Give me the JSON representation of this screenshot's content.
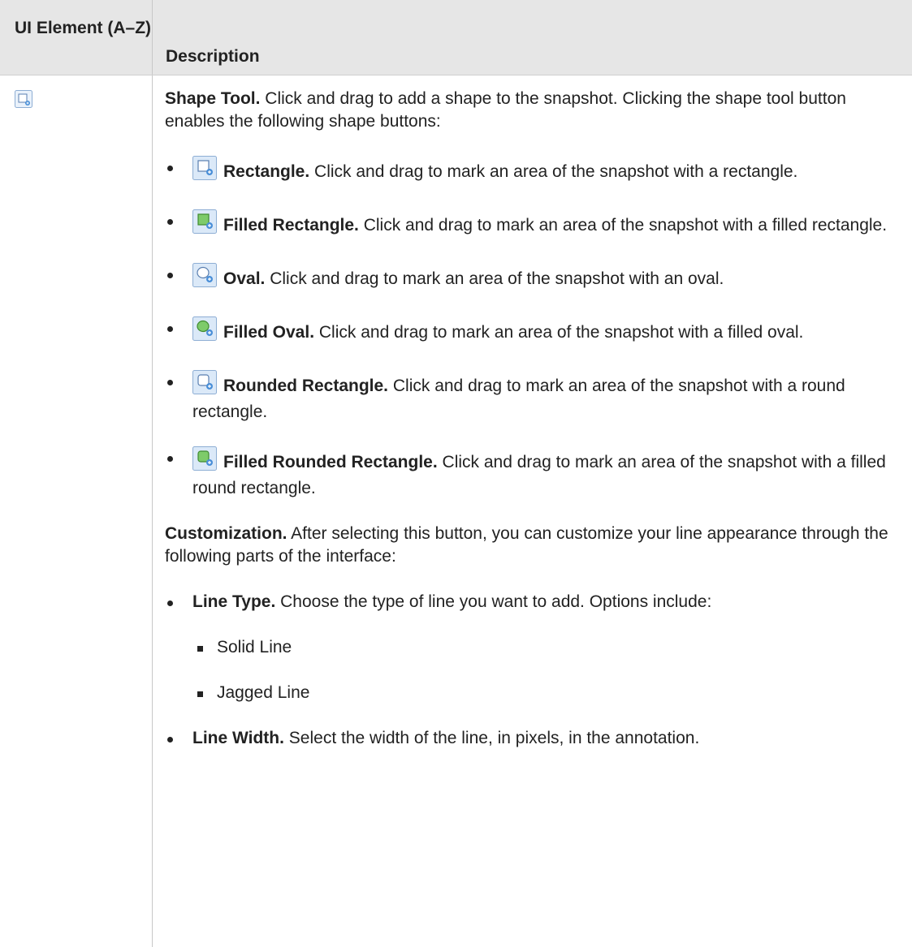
{
  "header": {
    "col1": "UI Element (A–Z)",
    "col2": "Description"
  },
  "row": {
    "element_icon": "shape-tool-icon",
    "title": "Shape Tool.",
    "intro": " Click and drag to add a shape to the snapshot. Clicking the shape tool button enables the following shape buttons:",
    "shapes": [
      {
        "icon": "rectangle-icon",
        "name": "Rectangle.",
        "desc": " Click and drag to mark an area of the snapshot with a rectangle."
      },
      {
        "icon": "filled-rectangle-icon",
        "name": "Filled Rectangle.",
        "desc": " Click and drag to mark an area of the snapshot with a filled rectangle."
      },
      {
        "icon": "oval-icon",
        "name": "Oval.",
        "desc": " Click and drag to mark an area of the snapshot with an oval."
      },
      {
        "icon": "filled-oval-icon",
        "name": "Filled Oval.",
        "desc": " Click and drag to mark an area of the snapshot with a filled oval."
      },
      {
        "icon": "rounded-rectangle-icon",
        "name": "Rounded Rectangle.",
        "desc": " Click and drag to mark an area of the snapshot with a round rectangle."
      },
      {
        "icon": "filled-rounded-rectangle-icon",
        "name": "Filled Rounded Rectangle.",
        "desc": " Click and drag to mark an area of the snapshot with a filled round rectangle."
      }
    ],
    "customization_title": "Customization.",
    "customization_text": " After selecting this button, you can customize your line appearance through the following parts of the interface:",
    "options": [
      {
        "name": "Line Type.",
        "desc": " Choose the type of line you want to add. Options include:",
        "subitems": [
          "Solid Line",
          "Jagged Line"
        ]
      },
      {
        "name": "Line Width.",
        "desc": " Select the width of the line, in pixels, in the annotation."
      }
    ]
  },
  "colors": {
    "header_bg": "#e6e6e6",
    "border": "#c8c8c8",
    "icon_blue": "#4a8fd8"
  }
}
